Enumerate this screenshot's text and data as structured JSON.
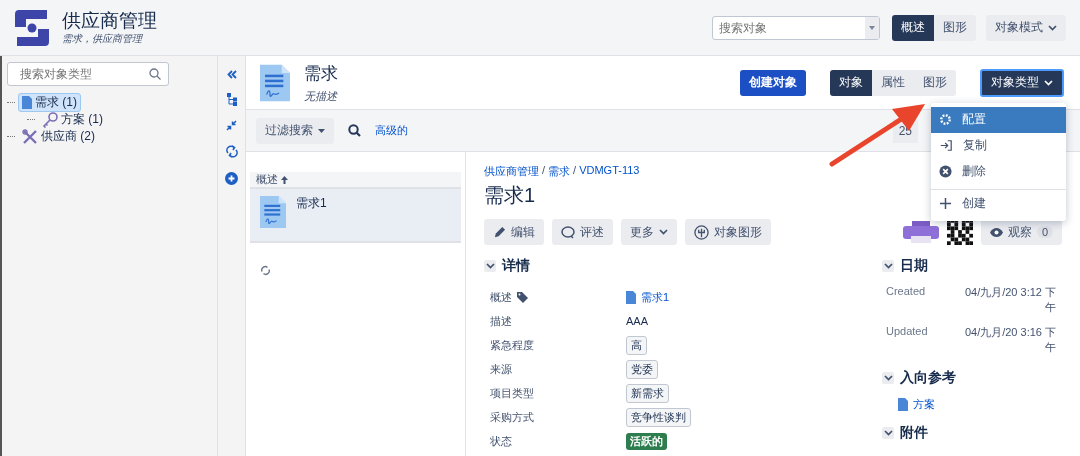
{
  "app": {
    "title": "供应商管理",
    "subtitle": "需求，供应商管理"
  },
  "global_search": {
    "placeholder": "搜索对象"
  },
  "view_tabs": [
    {
      "label": "概述",
      "selected": true
    },
    {
      "label": "图形",
      "selected": false
    }
  ],
  "mode_button": "对象模式",
  "type_search": {
    "placeholder": "搜索对象类型"
  },
  "tree": [
    {
      "label": "需求 (1)",
      "kind": "document",
      "selected": true,
      "children": [
        {
          "label": "方案 (1)",
          "kind": "key",
          "selected": false
        }
      ]
    },
    {
      "label": "供应商 (2)",
      "kind": "tools",
      "selected": false
    }
  ],
  "object_type": {
    "name": "需求",
    "description": "无描述"
  },
  "create_button": "创建对象",
  "type_tabs": [
    {
      "label": "对象",
      "selected": true
    },
    {
      "label": "属性",
      "selected": false
    },
    {
      "label": "图形",
      "selected": false
    }
  ],
  "type_menu": {
    "label": "对象类型",
    "expanded": true,
    "items": [
      {
        "label": "配置",
        "kind": "gear",
        "selected": true
      },
      {
        "label": "复制",
        "kind": "enter",
        "selected": false
      },
      {
        "label": "删除",
        "kind": "remove",
        "selected": false
      },
      {
        "label": "创建",
        "kind": "plus",
        "selected": false
      }
    ]
  },
  "filter": {
    "label": "过滤搜索",
    "advanced": "高级的"
  },
  "pagination": "25",
  "list": {
    "header": "概述",
    "items": [
      {
        "label": "需求1",
        "selected": true
      }
    ]
  },
  "object": {
    "breadcrumb_separator": "/",
    "breadcrumbs": [
      "供应商管理",
      "需求",
      "VDMGT-113"
    ],
    "title": "需求1",
    "actions": [
      {
        "label": "编辑",
        "kind": "pencil"
      },
      {
        "label": "评述",
        "kind": "comment"
      },
      {
        "label": "更多",
        "kind": "caret"
      },
      {
        "label": "对象图形",
        "kind": "graph"
      }
    ],
    "watch": {
      "label": "观察",
      "count": "0"
    }
  },
  "details": {
    "title": "详情",
    "rows": [
      {
        "label": "概述",
        "kind": "link",
        "value": "需求1"
      },
      {
        "label": "描述",
        "kind": "text",
        "value": "AAA"
      },
      {
        "label": "紧急程度",
        "kind": "tag",
        "value": "高"
      },
      {
        "label": "来源",
        "kind": "tag",
        "value": "党委"
      },
      {
        "label": "项目类型",
        "kind": "tag",
        "value": "新需求"
      },
      {
        "label": "采购方式",
        "kind": "tag",
        "value": "竞争性谈判"
      },
      {
        "label": "状态",
        "kind": "status",
        "value": "活跃的",
        "color": "#2e7d4f"
      }
    ]
  },
  "dates": {
    "title": "日期",
    "rows": [
      {
        "label": "Created",
        "value": "04/九月/20 3:12 下午"
      },
      {
        "label": "Updated",
        "value": "04/九月/20 3:16 下午"
      }
    ]
  },
  "inbound": {
    "title": "入向参考",
    "links": [
      "方案"
    ]
  },
  "attachments": {
    "title": "附件"
  }
}
